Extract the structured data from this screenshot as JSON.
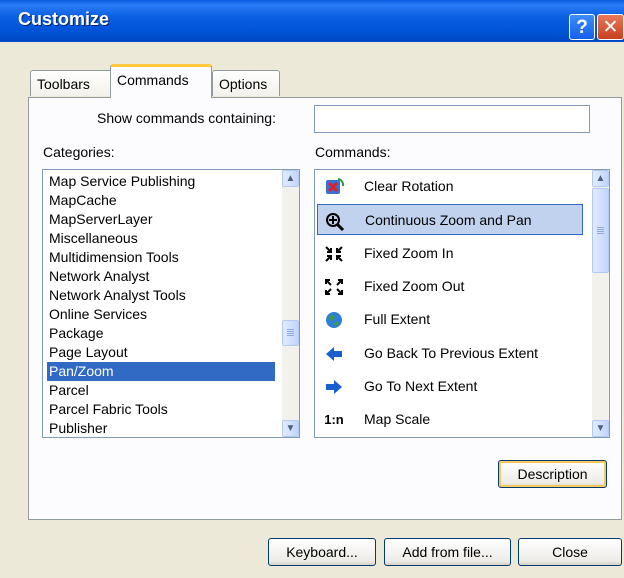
{
  "window": {
    "title": "Customize"
  },
  "tabs": [
    {
      "label": "Toolbars",
      "accel": "b"
    },
    {
      "label": "Commands",
      "accel": "C"
    },
    {
      "label": "Options",
      "accel": "O"
    }
  ],
  "search": {
    "label": "Show commands containing:",
    "value": ""
  },
  "categories": {
    "label": "Categories:",
    "items": [
      "Map Service Publishing",
      "MapCache",
      "MapServerLayer",
      "Miscellaneous",
      "Multidimension Tools",
      "Network Analyst",
      "Network Analyst Tools",
      "Online Services",
      "Package",
      "Page Layout",
      "Pan/Zoom",
      "Parcel",
      "Parcel Fabric Tools",
      "Publisher"
    ],
    "selected": "Pan/Zoom"
  },
  "commands": {
    "label": "Commands:",
    "items": [
      {
        "label": "Clear Rotation",
        "icon": "clear-rotation-icon"
      },
      {
        "label": "Continuous Zoom and Pan",
        "icon": "continuous-zoom-pan-icon"
      },
      {
        "label": "Fixed Zoom In",
        "icon": "fixed-zoom-in-icon"
      },
      {
        "label": "Fixed Zoom Out",
        "icon": "fixed-zoom-out-icon"
      },
      {
        "label": "Full Extent",
        "icon": "globe-icon"
      },
      {
        "label": "Go Back To Previous Extent",
        "icon": "arrow-left-icon"
      },
      {
        "label": "Go To Next Extent",
        "icon": "arrow-right-icon"
      },
      {
        "label": "Map Scale",
        "icon": "map-scale-icon",
        "icon_text": "1:n"
      }
    ],
    "selected": "Continuous Zoom and Pan"
  },
  "buttons": {
    "description": "Description",
    "keyboard": "Keyboard...",
    "add_from_file": "Add from file...",
    "close": "Close"
  },
  "colors": {
    "titlebar": "#0054e3",
    "selection": "#316ac5",
    "face": "#ece9d8"
  }
}
